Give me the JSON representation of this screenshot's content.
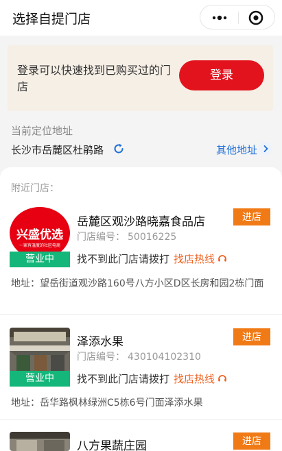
{
  "header": {
    "title": "选择自提门店",
    "more_icon": "more-dots-icon",
    "close_icon": "target-circle-icon"
  },
  "login": {
    "prompt": "登录可以快速找到已购买过的门店",
    "button": "登录"
  },
  "location": {
    "label": "当前定位地址",
    "value": "长沙市岳麓区杜鹃路",
    "other": "其他地址"
  },
  "nearby": {
    "label": "附近门店："
  },
  "stores": [
    {
      "name": "岳麓区观沙路晓嘉食品店",
      "code_label": "门店编号：",
      "code": "50016225",
      "status": "营业中",
      "hint": "找不到此门店请拨打",
      "hotline": "找店热线",
      "enter": "进店",
      "address": "地址：望岳街道观沙路160号八方小区D区长房和园2栋门面",
      "logo_brand": "兴盛优选",
      "logo_tagline": "一家有温度的社区电商"
    },
    {
      "name": "泽添水果",
      "code_label": "门店编号：",
      "code": "430104102310",
      "status": "营业中",
      "hint": "找不到此门店请拨打",
      "hotline": "找店热线",
      "enter": "进店",
      "address": "地址：岳华路枫林绿洲C5栋6号门面泽添水果"
    },
    {
      "name": "八方果蔬庄园",
      "enter": "进店"
    }
  ],
  "colors": {
    "brand_red": "#e3131d",
    "enter_orange": "#f07a16",
    "hotline_orange": "#f0601e",
    "open_green": "#14b67a",
    "link_blue": "#1e6fd9"
  }
}
